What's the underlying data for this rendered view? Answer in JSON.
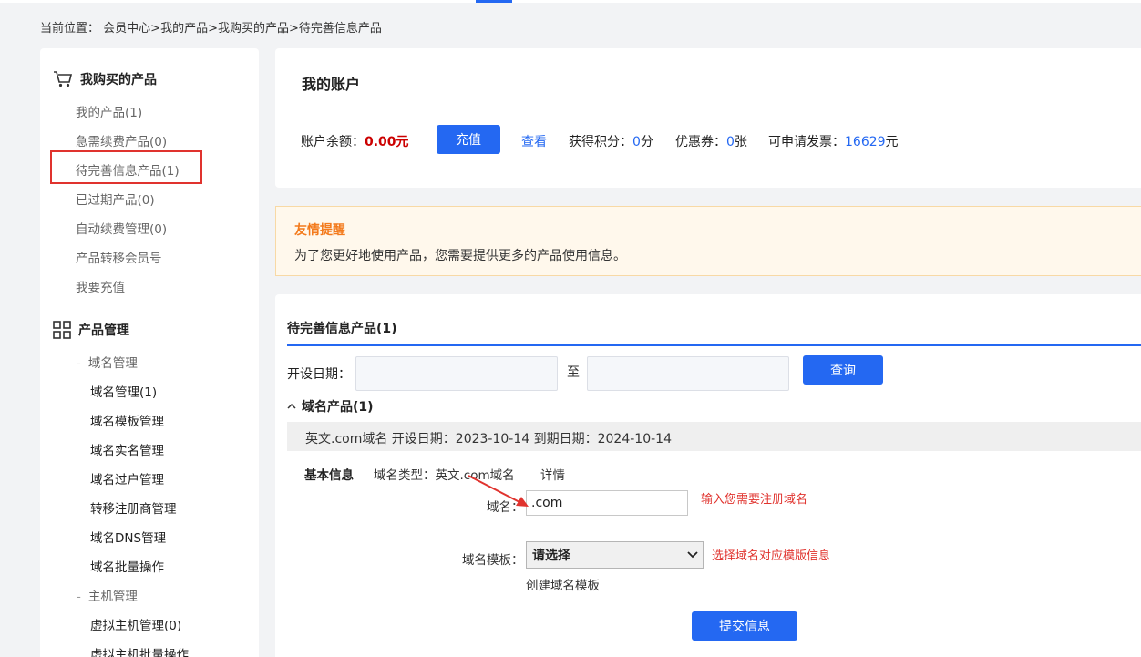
{
  "breadcrumb": {
    "prefix": "当前位置：",
    "items": [
      "会员中心",
      "我的产品",
      "我购买的产品",
      "待完善信息产品"
    ],
    "sep": ">"
  },
  "sidebar": {
    "section1_title": "我购买的产品",
    "section1_items": [
      "我的产品(1)",
      "急需续费产品(0)",
      "待完善信息产品(1)",
      "已过期产品(0)",
      "自动续费管理(0)",
      "产品转移会员号",
      "我要充值"
    ],
    "section2_title": "产品管理",
    "group1_label": "域名管理",
    "group1_items": [
      "域名管理(1)",
      "域名模板管理",
      "域名实名管理",
      "域名过户管理",
      "转移注册商管理",
      "域名DNS管理",
      "域名批量操作"
    ],
    "group2_label": "主机管理",
    "group2_items": [
      "虚拟主机管理(0)",
      "虚拟主机批量操作"
    ]
  },
  "account": {
    "title": "我的账户",
    "balance_label": "账户余额：",
    "balance_value": "0.00元",
    "recharge_button": "充值",
    "view_link": "查看",
    "points_label": "获得积分：",
    "points_value": "0",
    "points_unit": "分",
    "coupon_label": "优惠券：",
    "coupon_value": "0",
    "coupon_unit": "张",
    "invoice_label": "可申请发票：",
    "invoice_value": "16629",
    "invoice_unit": "元"
  },
  "notice": {
    "title": "友情提醒",
    "text": "为了您更好地使用产品，您需要提供更多的产品使用信息。"
  },
  "products": {
    "title": "待完善信息产品(1)",
    "date_label": "开设日期：",
    "to_label": "至",
    "query_button": "查询",
    "group_title": "域名产品(1)",
    "row_text": "英文.com域名 开设日期：2023-10-14 到期日期：2024-10-14",
    "basic_info_label": "基本信息",
    "domain_type_label": "域名类型：英文.com域名",
    "detail_link": "详情",
    "domain_label": "域名：",
    "domain_value": ".com",
    "domain_hint": "输入您需要注册域名",
    "template_label": "域名模板：",
    "template_selected": "请选择",
    "template_hint": "选择域名对应模版信息",
    "create_template_link": "创建域名模板",
    "submit_button": "提交信息"
  },
  "colors": {
    "primary": "#2468f2",
    "danger": "#e0332e",
    "warning": "#f37b1d"
  }
}
